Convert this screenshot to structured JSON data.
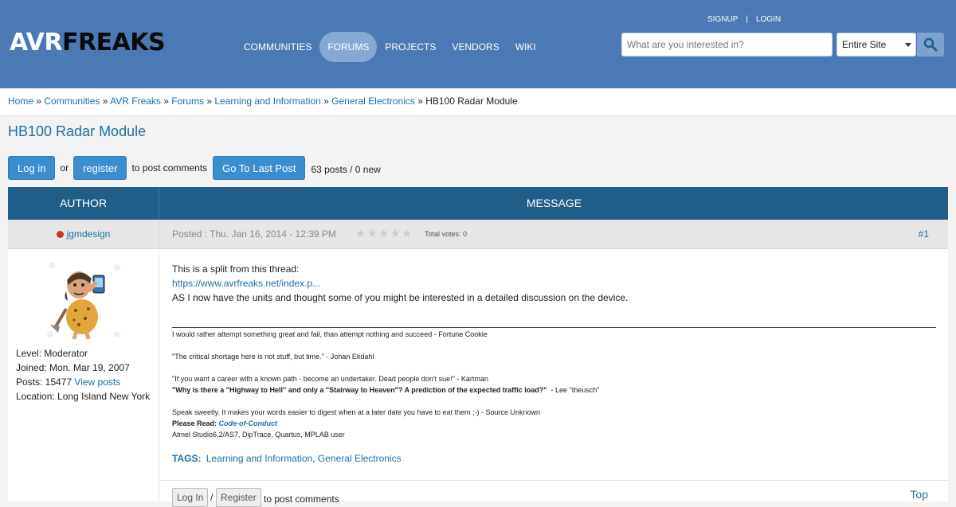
{
  "header": {
    "logo_a": "AVR",
    "logo_b": "FREAKS",
    "nav": [
      "COMMUNITIES",
      "FORUMS",
      "PROJECTS",
      "VENDORS",
      "WIKI"
    ],
    "signup": "SIGNUP",
    "divider": "|",
    "login": "LOGIN",
    "search_placeholder": "What are you interested in?",
    "scope": "Entire Site"
  },
  "breadcrumb": [
    "Home",
    "Communities",
    "AVR Freaks",
    "Forums",
    "Learning and Information",
    "General Electronics",
    "HB100 Radar Module"
  ],
  "breadcrumb_sep": "»",
  "page": {
    "title": "HB100 Radar Module",
    "login_btn": "Log in",
    "or": "or",
    "register_btn": "register",
    "to_post": "to post comments",
    "last_post_btn": "Go To Last Post",
    "count": "63 posts / 0 new"
  },
  "table": {
    "author": "AUTHOR",
    "message": "MESSAGE"
  },
  "post": {
    "author": "jgmdesign",
    "posted": "Posted : Thu. Jan 16, 2014 - 12:39 PM",
    "votes": "Total votes: 0",
    "number": "#1",
    "rating": 0,
    "info": {
      "level": "Level: Moderator",
      "joined": "Joined: Mon. Mar 19, 2007",
      "posts": "Posts: 15477",
      "view_posts": "View posts",
      "location": "Location: Long Island New York"
    },
    "body": [
      "This is a split from this thread:",
      "https://www.avrfreaks.net/index.p...",
      "AS I now have the units and thought some of you might be interested in a detailed discussion on the device."
    ],
    "signature": {
      "l1": "I would rather attempt something great and fail, than attempt nothing and succeed - Fortune Cookie",
      "l2": "\"The critical shortage here is not stuff, but time.\" - Johan Ekdahl",
      "l3": "\"If you want a career with a known path - become an undertaker. Dead people don't sue!\" - Kartman",
      "l4_bold": "\"Why is there a \"Highway to Hell\" and only a \"Stairway to Heaven\"? A prediction of the expected traffic load?\"",
      "l4_rest": "  - Lee \"theusch\"",
      "l5": "Speak sweetly. It makes your words easier to digest when at a later date you have to eat them ;-)  - Source Unknown",
      "l6_label": "Please Read: ",
      "l6_link": "Code-of-Conduct",
      "l7": "Atmel Studio6.2/AS7, DipTrace, Quartus, MPLAB user"
    },
    "tags_label": "TAGS:",
    "tags": [
      "Learning and Information",
      "General Electronics"
    ],
    "tag_sep": ",",
    "foot_login": "Log In",
    "foot_slash": "/",
    "foot_register": "Register",
    "foot_after": "to post comments",
    "top": "Top"
  },
  "colors": {
    "header": "#4a7ab5",
    "table_head": "#1f5e88",
    "button": "#3a8dcf",
    "link": "#1d6fa6"
  }
}
